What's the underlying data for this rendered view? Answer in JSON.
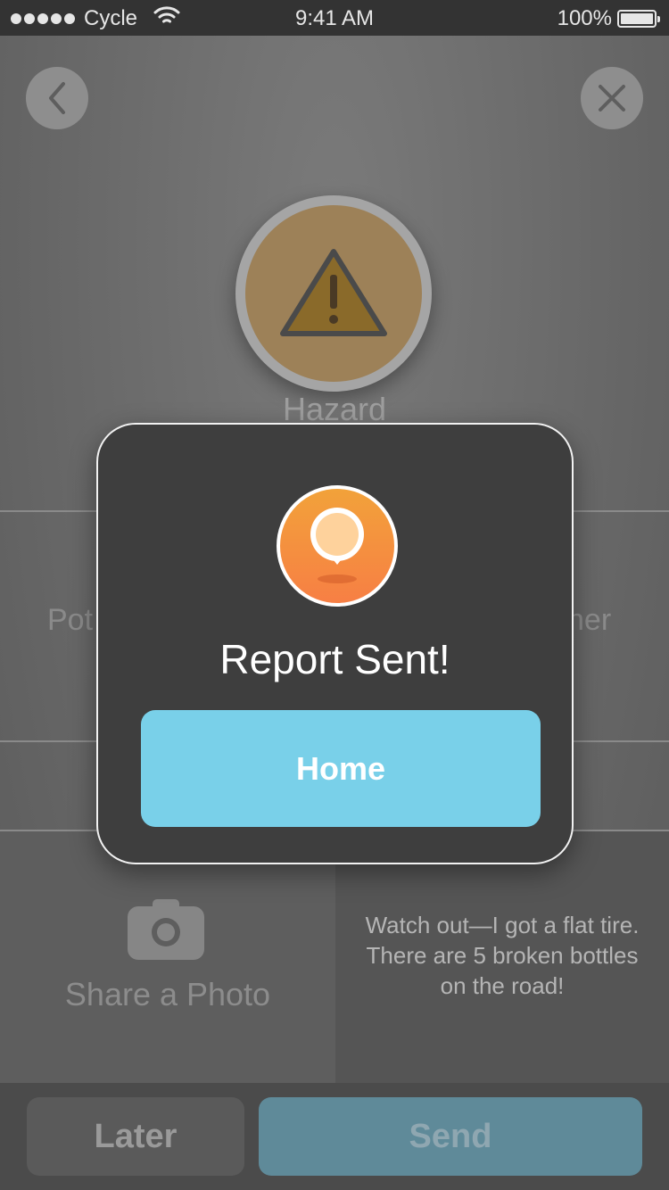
{
  "status_bar": {
    "carrier": "Cycle",
    "time": "9:41 AM",
    "battery": "100%",
    "wifi_icon": "wifi-icon",
    "signal_icon": "signal-dots-icon",
    "battery_icon": "battery-icon"
  },
  "nav": {
    "back_icon": "chevron-left-icon",
    "close_icon": "close-icon"
  },
  "category": {
    "label": "Hazard",
    "icon": "warning-triangle-icon"
  },
  "grid": {
    "left_option_partial": "Pot",
    "right_option_partial": "her"
  },
  "photo": {
    "label": "Share a Photo",
    "icon": "camera-icon"
  },
  "note": {
    "text": "Watch out—I got a flat tire.  There are 5 broken bottles on the road!"
  },
  "actions": {
    "later_label": "Later",
    "send_label": "Send"
  },
  "modal": {
    "icon": "location-pin-icon",
    "title": "Report Sent!",
    "button_label": "Home"
  },
  "colors": {
    "accent_blue": "#79d0e9",
    "pin_orange_top": "#f2a23a",
    "pin_orange_bottom": "#f77f44",
    "modal_bg": "#3e3e3e"
  }
}
